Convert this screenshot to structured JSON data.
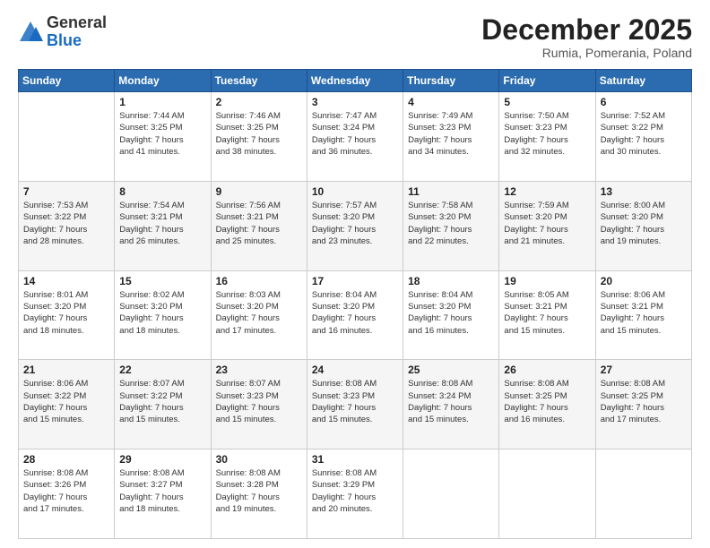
{
  "header": {
    "logo": {
      "general": "General",
      "blue": "Blue"
    },
    "title": "December 2025",
    "location": "Rumia, Pomerania, Poland"
  },
  "weekdays": [
    "Sunday",
    "Monday",
    "Tuesday",
    "Wednesday",
    "Thursday",
    "Friday",
    "Saturday"
  ],
  "weeks": [
    [
      {
        "day": "",
        "info": ""
      },
      {
        "day": "1",
        "info": "Sunrise: 7:44 AM\nSunset: 3:25 PM\nDaylight: 7 hours\nand 41 minutes."
      },
      {
        "day": "2",
        "info": "Sunrise: 7:46 AM\nSunset: 3:25 PM\nDaylight: 7 hours\nand 38 minutes."
      },
      {
        "day": "3",
        "info": "Sunrise: 7:47 AM\nSunset: 3:24 PM\nDaylight: 7 hours\nand 36 minutes."
      },
      {
        "day": "4",
        "info": "Sunrise: 7:49 AM\nSunset: 3:23 PM\nDaylight: 7 hours\nand 34 minutes."
      },
      {
        "day": "5",
        "info": "Sunrise: 7:50 AM\nSunset: 3:23 PM\nDaylight: 7 hours\nand 32 minutes."
      },
      {
        "day": "6",
        "info": "Sunrise: 7:52 AM\nSunset: 3:22 PM\nDaylight: 7 hours\nand 30 minutes."
      }
    ],
    [
      {
        "day": "7",
        "info": "Sunrise: 7:53 AM\nSunset: 3:22 PM\nDaylight: 7 hours\nand 28 minutes."
      },
      {
        "day": "8",
        "info": "Sunrise: 7:54 AM\nSunset: 3:21 PM\nDaylight: 7 hours\nand 26 minutes."
      },
      {
        "day": "9",
        "info": "Sunrise: 7:56 AM\nSunset: 3:21 PM\nDaylight: 7 hours\nand 25 minutes."
      },
      {
        "day": "10",
        "info": "Sunrise: 7:57 AM\nSunset: 3:20 PM\nDaylight: 7 hours\nand 23 minutes."
      },
      {
        "day": "11",
        "info": "Sunrise: 7:58 AM\nSunset: 3:20 PM\nDaylight: 7 hours\nand 22 minutes."
      },
      {
        "day": "12",
        "info": "Sunrise: 7:59 AM\nSunset: 3:20 PM\nDaylight: 7 hours\nand 21 minutes."
      },
      {
        "day": "13",
        "info": "Sunrise: 8:00 AM\nSunset: 3:20 PM\nDaylight: 7 hours\nand 19 minutes."
      }
    ],
    [
      {
        "day": "14",
        "info": "Sunrise: 8:01 AM\nSunset: 3:20 PM\nDaylight: 7 hours\nand 18 minutes."
      },
      {
        "day": "15",
        "info": "Sunrise: 8:02 AM\nSunset: 3:20 PM\nDaylight: 7 hours\nand 18 minutes."
      },
      {
        "day": "16",
        "info": "Sunrise: 8:03 AM\nSunset: 3:20 PM\nDaylight: 7 hours\nand 17 minutes."
      },
      {
        "day": "17",
        "info": "Sunrise: 8:04 AM\nSunset: 3:20 PM\nDaylight: 7 hours\nand 16 minutes."
      },
      {
        "day": "18",
        "info": "Sunrise: 8:04 AM\nSunset: 3:20 PM\nDaylight: 7 hours\nand 16 minutes."
      },
      {
        "day": "19",
        "info": "Sunrise: 8:05 AM\nSunset: 3:21 PM\nDaylight: 7 hours\nand 15 minutes."
      },
      {
        "day": "20",
        "info": "Sunrise: 8:06 AM\nSunset: 3:21 PM\nDaylight: 7 hours\nand 15 minutes."
      }
    ],
    [
      {
        "day": "21",
        "info": "Sunrise: 8:06 AM\nSunset: 3:22 PM\nDaylight: 7 hours\nand 15 minutes."
      },
      {
        "day": "22",
        "info": "Sunrise: 8:07 AM\nSunset: 3:22 PM\nDaylight: 7 hours\nand 15 minutes."
      },
      {
        "day": "23",
        "info": "Sunrise: 8:07 AM\nSunset: 3:23 PM\nDaylight: 7 hours\nand 15 minutes."
      },
      {
        "day": "24",
        "info": "Sunrise: 8:08 AM\nSunset: 3:23 PM\nDaylight: 7 hours\nand 15 minutes."
      },
      {
        "day": "25",
        "info": "Sunrise: 8:08 AM\nSunset: 3:24 PM\nDaylight: 7 hours\nand 15 minutes."
      },
      {
        "day": "26",
        "info": "Sunrise: 8:08 AM\nSunset: 3:25 PM\nDaylight: 7 hours\nand 16 minutes."
      },
      {
        "day": "27",
        "info": "Sunrise: 8:08 AM\nSunset: 3:25 PM\nDaylight: 7 hours\nand 17 minutes."
      }
    ],
    [
      {
        "day": "28",
        "info": "Sunrise: 8:08 AM\nSunset: 3:26 PM\nDaylight: 7 hours\nand 17 minutes."
      },
      {
        "day": "29",
        "info": "Sunrise: 8:08 AM\nSunset: 3:27 PM\nDaylight: 7 hours\nand 18 minutes."
      },
      {
        "day": "30",
        "info": "Sunrise: 8:08 AM\nSunset: 3:28 PM\nDaylight: 7 hours\nand 19 minutes."
      },
      {
        "day": "31",
        "info": "Sunrise: 8:08 AM\nSunset: 3:29 PM\nDaylight: 7 hours\nand 20 minutes."
      },
      {
        "day": "",
        "info": ""
      },
      {
        "day": "",
        "info": ""
      },
      {
        "day": "",
        "info": ""
      }
    ]
  ]
}
